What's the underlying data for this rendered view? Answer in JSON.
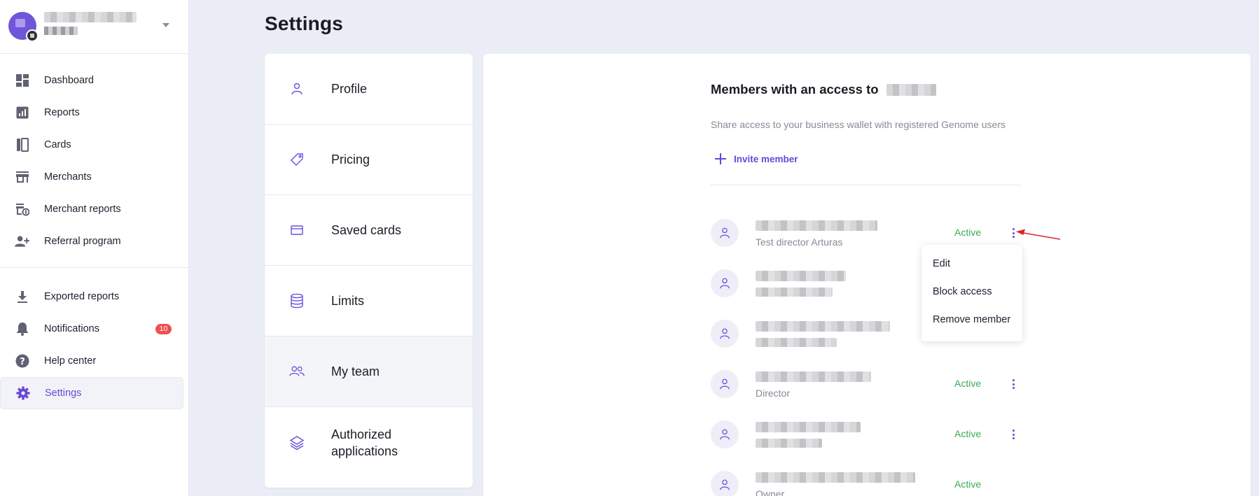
{
  "sidebar": {
    "items": [
      {
        "label": "Dashboard",
        "icon": "dashboard-icon"
      },
      {
        "label": "Reports",
        "icon": "reports-icon"
      },
      {
        "label": "Cards",
        "icon": "cards-icon"
      },
      {
        "label": "Merchants",
        "icon": "store-icon"
      },
      {
        "label": "Merchant reports",
        "icon": "merchant-reports-icon"
      },
      {
        "label": "Referral program",
        "icon": "add-person-icon"
      }
    ],
    "items2": [
      {
        "label": "Exported reports",
        "icon": "download-icon"
      },
      {
        "label": "Notifications",
        "icon": "bell-icon",
        "badge": "10"
      },
      {
        "label": "Help center",
        "icon": "help-icon"
      },
      {
        "label": "Settings",
        "icon": "gear-icon"
      }
    ]
  },
  "page": {
    "title": "Settings"
  },
  "settings_menu": [
    {
      "label": "Profile",
      "icon": "person-icon"
    },
    {
      "label": "Pricing",
      "icon": "tag-icon"
    },
    {
      "label": "Saved cards",
      "icon": "credit-card-icon"
    },
    {
      "label": "Limits",
      "icon": "database-icon"
    },
    {
      "label": "My team",
      "icon": "team-icon"
    },
    {
      "label": "Authorized applications",
      "icon": "layers-icon"
    }
  ],
  "members": {
    "title": "Members with an access to",
    "description": "Share access to your business wallet with registered Genome users",
    "invite_label": "Invite member",
    "list": [
      {
        "role": "Test director Arturas",
        "status": "Active"
      },
      {
        "role": "",
        "status": ""
      },
      {
        "role": "",
        "status": ""
      },
      {
        "role": "Director",
        "status": "Active"
      },
      {
        "role": "",
        "status": "Active"
      },
      {
        "role": "Owner",
        "status": "Active"
      }
    ]
  },
  "dropdown": {
    "items": [
      "Edit",
      "Block access",
      "Remove member"
    ]
  },
  "colors": {
    "accent": "#6748d8",
    "active_status": "#3dab54",
    "badge": "#ec5050",
    "annotation_arrow": "#d9262c"
  }
}
